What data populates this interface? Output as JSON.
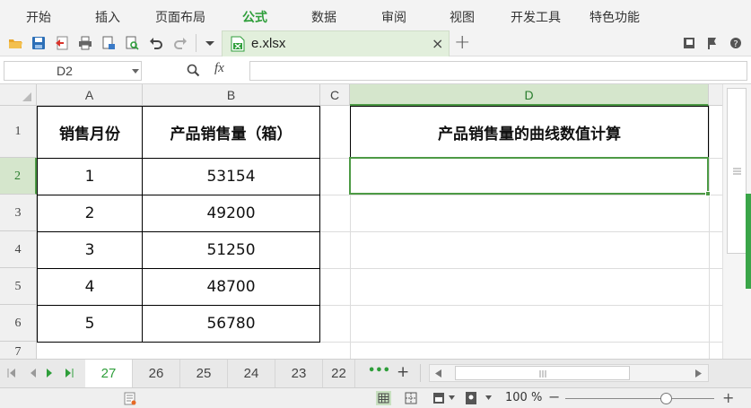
{
  "menu": {
    "items": [
      "开始",
      "插入",
      "页面布局",
      "公式",
      "数据",
      "审阅",
      "视图",
      "开发工具",
      "特色功能"
    ],
    "active_index": 3
  },
  "file_tab": {
    "name": "e.xlsx",
    "close": "×",
    "new_tab": "+"
  },
  "formula_bar": {
    "name_box": "D2",
    "fx": "fx",
    "value": ""
  },
  "columns": [
    "A",
    "B",
    "C",
    "D"
  ],
  "rows": [
    "1",
    "2",
    "3",
    "4",
    "5",
    "6",
    "7"
  ],
  "table": {
    "headers": [
      "销售月份",
      "产品销售量（箱）"
    ],
    "data": [
      [
        "1",
        "53154"
      ],
      [
        "2",
        "49200"
      ],
      [
        "3",
        "51250"
      ],
      [
        "4",
        "48700"
      ],
      [
        "5",
        "56780"
      ]
    ]
  },
  "d_header": "产品销售量的曲线数值计算",
  "sheet_tabs": {
    "items": [
      "27",
      "26",
      "25",
      "24",
      "23",
      "22"
    ],
    "active_index": 0,
    "more": "•••",
    "add": "+"
  },
  "status": {
    "zoom": "100 %",
    "zoom_fraction": 0.68
  },
  "colors": {
    "accent": "#2e9e3a",
    "selection": "#4d9a45"
  }
}
